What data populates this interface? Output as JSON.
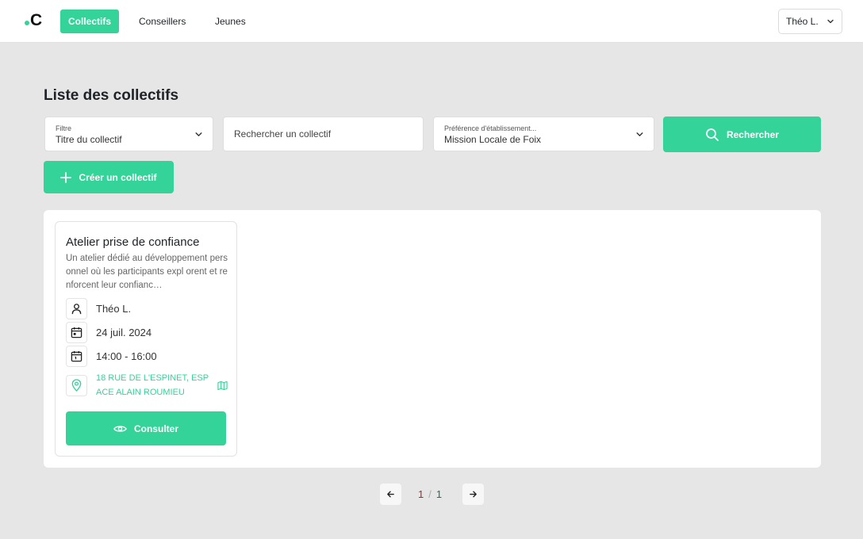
{
  "nav": {
    "logo": "C",
    "tabs": [
      {
        "label": "Collectifs",
        "active": true
      },
      {
        "label": "Conseillers",
        "active": false
      },
      {
        "label": "Jeunes",
        "active": false
      }
    ],
    "user": "Théo L."
  },
  "page": {
    "title": "Liste des collectifs"
  },
  "filters": {
    "filter_label": "Filtre",
    "filter_value": "Titre du collectif",
    "search_placeholder": "Rechercher un collectif",
    "pref_label": "Préférence d'établissement...",
    "pref_value": "Mission Locale de Foix",
    "search_button": "Rechercher",
    "create_button": "Créer un collectif"
  },
  "cards": [
    {
      "title": "Atelier prise de confiance",
      "description": "Un atelier dédié au développement personnel où les participants expl orent et renforcent leur confianc…",
      "advisor": "Théo L.",
      "date": "24 juil. 2024",
      "time": "14:00 - 16:00",
      "address": "18 RUE DE L'ESPINET, ESPACE ALAIN ROUMIEU",
      "button": "Consulter"
    }
  ],
  "pagination": {
    "current": "1",
    "separator": "/",
    "total": "1"
  },
  "colors": {
    "accent": "#34d399",
    "background": "#e6e6e6"
  }
}
